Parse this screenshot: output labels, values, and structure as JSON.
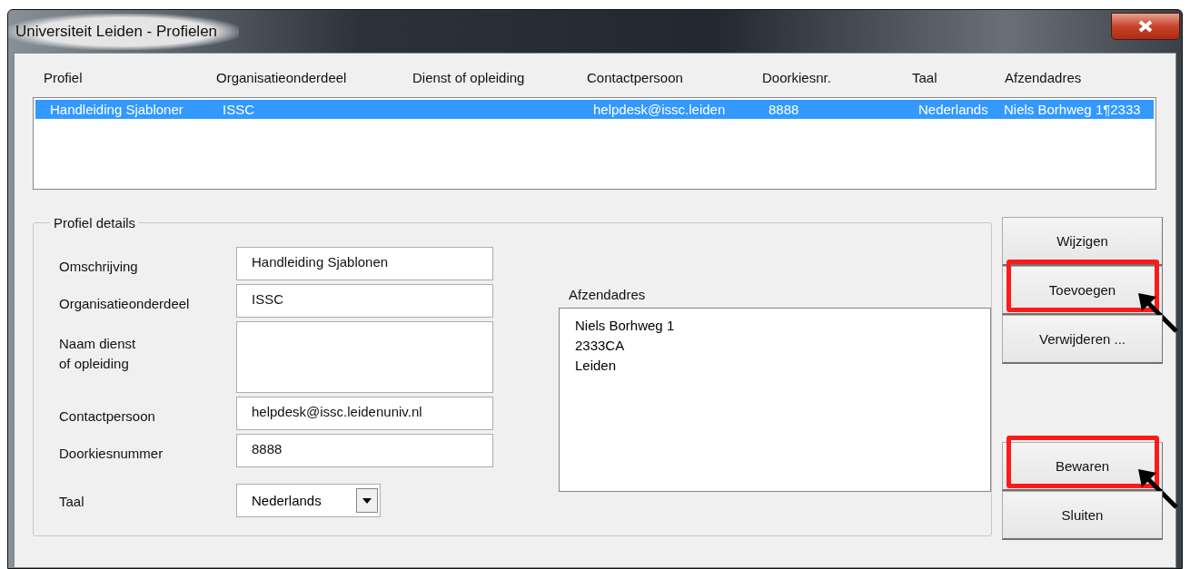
{
  "window": {
    "title": "Universiteit Leiden - Profielen"
  },
  "list": {
    "columns": [
      "Profiel",
      "Organisatieonderdeel",
      "Dienst of opleiding",
      "Contactpersoon",
      "Doorkiesnr.",
      "Taal",
      "Afzendadres"
    ],
    "rows": [
      {
        "cells": [
          "Handleiding Sjabloner",
          "ISSC",
          "",
          "helpdesk@issc.leiden",
          "8888",
          "Nederlands",
          "Niels Borhweg 1¶2333"
        ],
        "selected": true
      }
    ]
  },
  "details": {
    "title": "Profiel details",
    "fields": [
      {
        "kind": "text",
        "label": "Omschrijving",
        "value": "Handleiding Sjablonen"
      },
      {
        "kind": "text",
        "label": "Organisatieonderdeel",
        "value": "ISSC"
      },
      {
        "kind": "multiline",
        "label": "Naam dienst\nof opleiding"
      },
      {
        "kind": "text",
        "label": "Contactpersoon",
        "value": "helpdesk@issc.leidenuniv.nl"
      },
      {
        "kind": "text",
        "label": "Doorkiesnummer",
        "value": "8888"
      },
      {
        "kind": "dropdown",
        "label": "Taal",
        "value": "Nederlands"
      }
    ],
    "address": {
      "label": "Afzendadres",
      "value": "Niels Borhweg 1\n2333CA\nLeiden"
    }
  },
  "button_groups": [
    [
      {
        "label": "Wijzigen",
        "highlighted": false
      },
      {
        "label": "Toevoegen",
        "highlighted": true
      },
      {
        "label": "Verwijderen ...",
        "highlighted": false
      }
    ],
    [
      {
        "label": "Bewaren",
        "highlighted": true
      },
      {
        "label": "Sluiten",
        "highlighted": false
      }
    ]
  ]
}
